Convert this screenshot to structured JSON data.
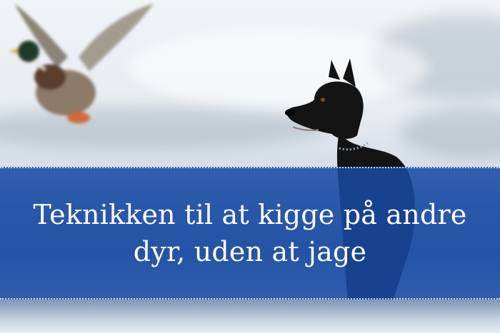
{
  "banner": {
    "line1": "Teknikken til at kigge på andre",
    "line2": "dyr, uden at jage"
  },
  "colors": {
    "banner": "#194ba5",
    "text": "#ffffff",
    "snow": "#eef2f6",
    "dog": "#141414"
  },
  "image": {
    "subjects": [
      "duck-icon",
      "dog-icon"
    ]
  }
}
